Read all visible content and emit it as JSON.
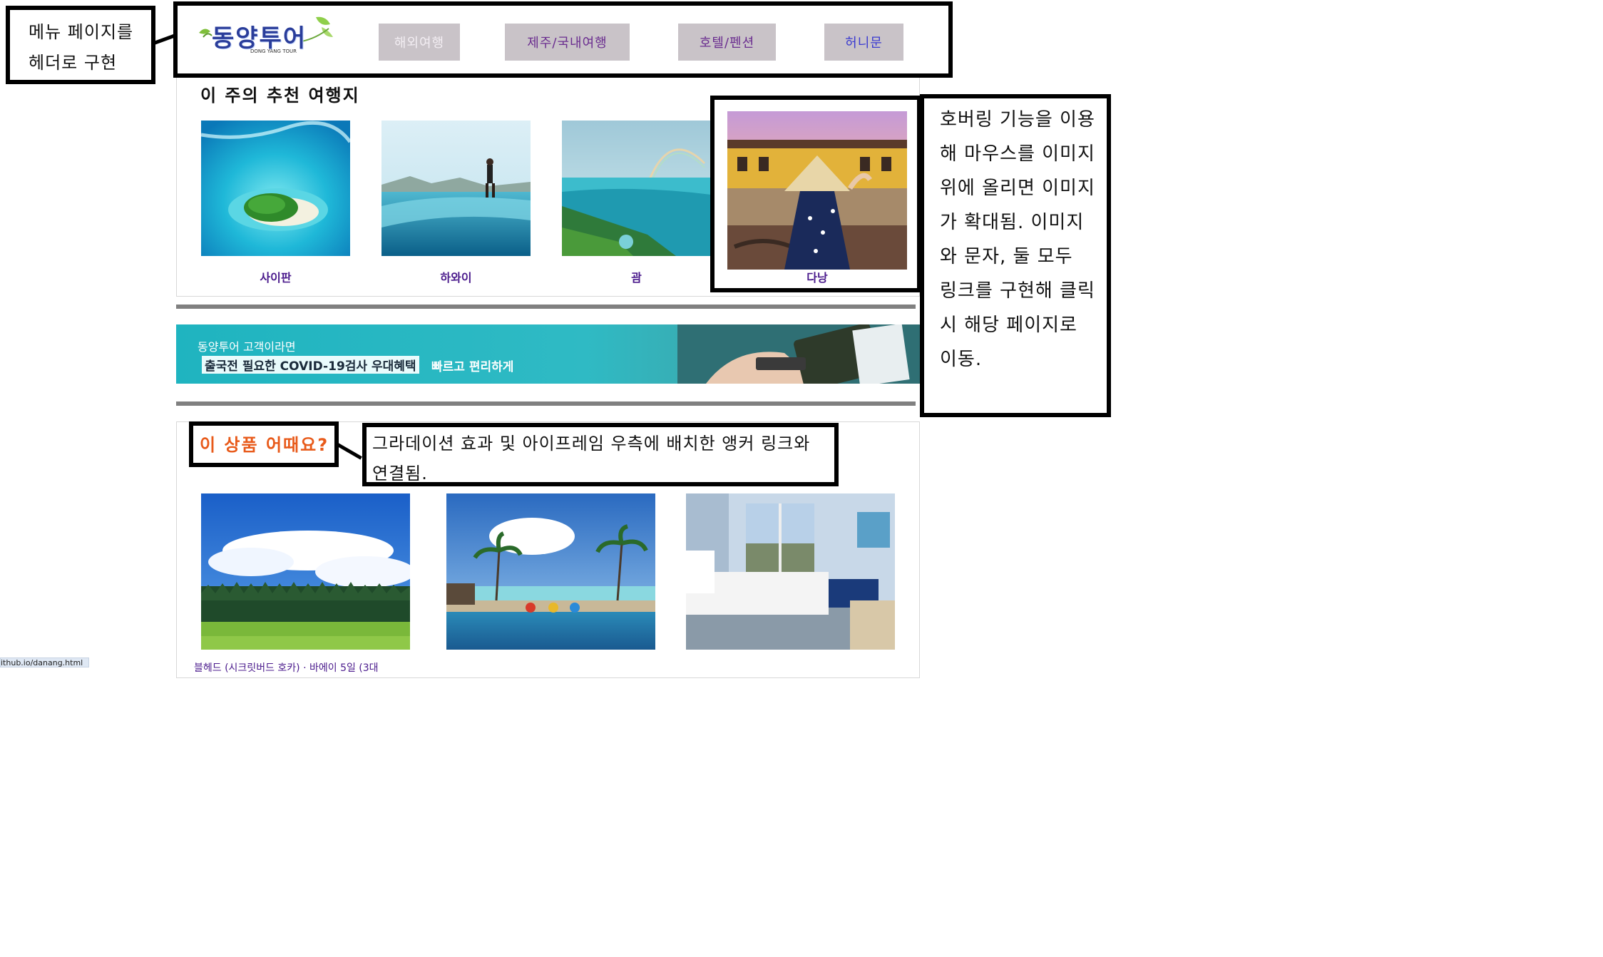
{
  "header": {
    "logo_text": "동양투어",
    "logo_subtext": "DONG YANG TOUR",
    "menu": [
      {
        "label": "해외여행"
      },
      {
        "label": "제주/국내여행"
      },
      {
        "label": "호텔/펜션"
      },
      {
        "label": "허니문"
      }
    ]
  },
  "recommend": {
    "title": "이 주의 추천 여행지",
    "cards": [
      {
        "label": "사이판"
      },
      {
        "label": "하와이"
      },
      {
        "label": "괌"
      },
      {
        "label": "다낭"
      }
    ]
  },
  "banner": {
    "line1": "동양투어 고객이라면",
    "line2_highlight": "출국전 필요한 COVID-19검사 우대혜택",
    "line2_rest": "빠르고 편리하게"
  },
  "product": {
    "title": "이 상품 어때요?",
    "caption_partial": "블헤드 (시크릿버드 호카) · 바에이 5일 (3대"
  },
  "annotations": {
    "header_note": "메뉴 페이지를 헤더로 구현",
    "hover_note": "호버링 기능을 이용해 마우스를 이미지 위에 올리면 이미지가 확대됨. 이미지와 문자, 둘 모두 링크를 구현해 클릭시 해당 페이지로 이동.",
    "gradation_note": "그라데이션 효과 및 아이프레임 우측에 배치한 앵커 링크와 연결됨."
  },
  "statusbar": {
    "url": "ithub.io/danang.html"
  }
}
